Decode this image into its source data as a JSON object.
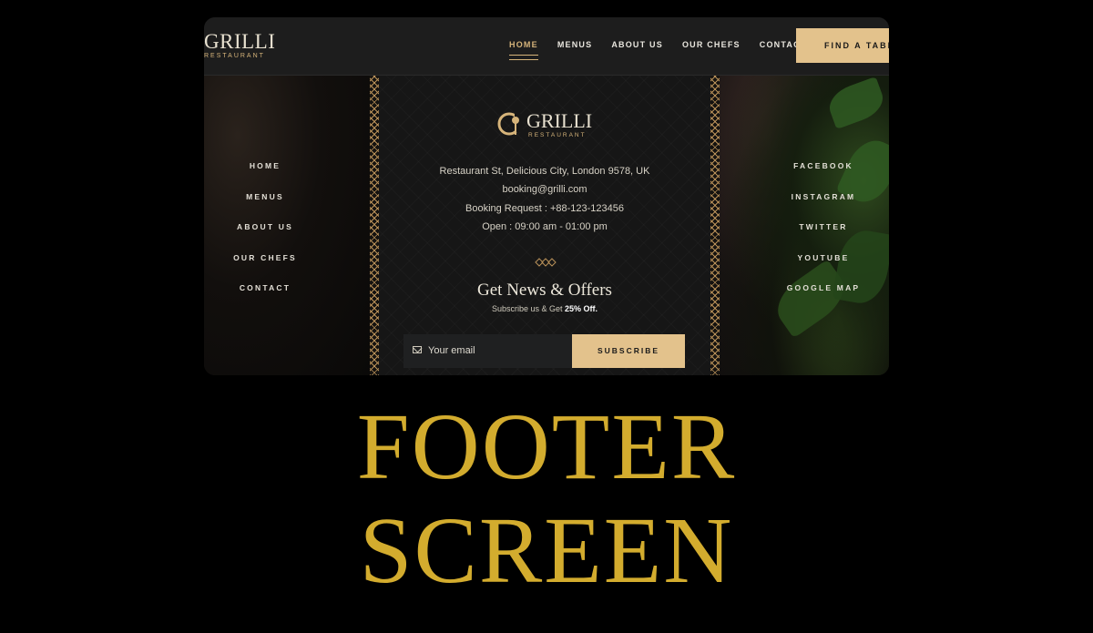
{
  "header": {
    "logo_text": "GRILLI",
    "logo_sub": "RESTAURANT",
    "nav": [
      "HOME",
      "MENUS",
      "ABOUT US",
      "OUR CHEFS",
      "CONTACT"
    ],
    "active_nav": "HOME",
    "cta_label": "FIND A TABL"
  },
  "footer": {
    "logo_text": "GRILLI",
    "logo_sub": "RESTAURANT",
    "left_links": [
      "HOME",
      "MENUS",
      "ABOUT US",
      "OUR CHEFS",
      "CONTACT"
    ],
    "right_links": [
      "FACEBOOK",
      "INSTAGRAM",
      "TWITTER",
      "YOUTUBE",
      "GOOGLE MAP"
    ],
    "address": "Restaurant St, Delicious City, London 9578, UK",
    "email": "booking@grilli.com",
    "booking": "Booking Request : +88-123-123456",
    "hours": "Open : 09:00 am - 01:00 pm",
    "news_title": "Get News & Offers",
    "news_sub_prefix": "Subscribe us & Get ",
    "news_sub_highlight": "25% Off.",
    "email_placeholder": "Your email",
    "subscribe_label": "SUBSCRIBE"
  },
  "caption": {
    "line1": "FOOTER",
    "line2": "SCREEN"
  },
  "colors": {
    "accent": "#e3c28c",
    "title_gold": "#d3ac2e",
    "background": "#000000"
  },
  "icons": [
    "logo-mark-icon",
    "mail-icon",
    "divider-ornament-icon"
  ]
}
